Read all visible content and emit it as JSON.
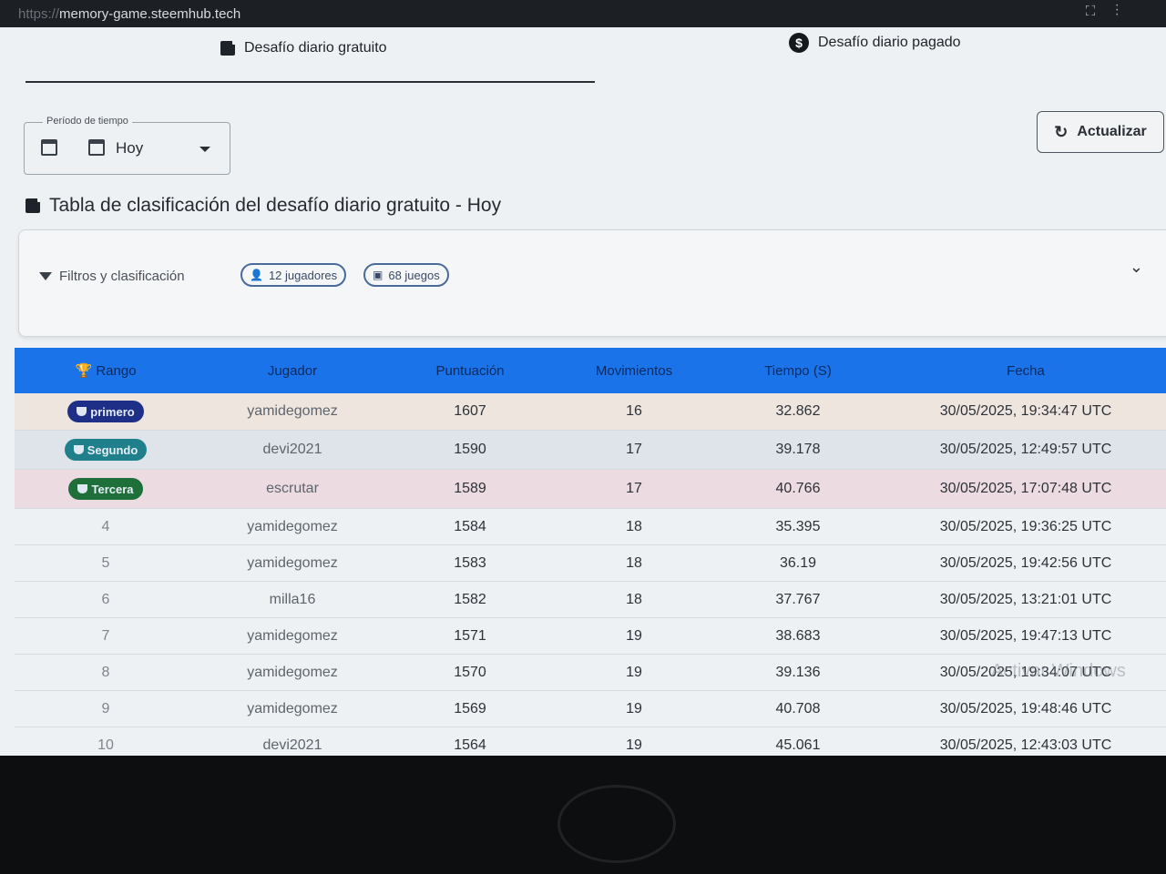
{
  "browser": {
    "scheme": "https://",
    "host": "memory-game.steemhub.tech"
  },
  "tabs": {
    "free": "Desafío diario gratuito",
    "paid": "Desafío diario pagado"
  },
  "period": {
    "label": "Período de tiempo",
    "value": "Hoy"
  },
  "refresh_label": "Actualizar",
  "board_title": "Tabla de clasificación del desafío diario gratuito - Hoy",
  "filters": {
    "label": "Filtros y clasificación",
    "players_chip": "12 jugadores",
    "games_chip": "68 juegos"
  },
  "table": {
    "headers": [
      "Rango",
      "Jugador",
      "Puntuación",
      "Movimientos",
      "Tiempo (S)",
      "Fecha"
    ],
    "rows": [
      {
        "rank": "primero",
        "player": "yamidegomez",
        "score": "1607",
        "moves": "16",
        "time": "32.862",
        "date": "30/05/2025, 19:34:47 UTC"
      },
      {
        "rank": "Segundo",
        "player": "devi2021",
        "score": "1590",
        "moves": "17",
        "time": "39.178",
        "date": "30/05/2025, 12:49:57 UTC"
      },
      {
        "rank": "Tercera",
        "player": "escrutar",
        "score": "1589",
        "moves": "17",
        "time": "40.766",
        "date": "30/05/2025, 17:07:48 UTC"
      },
      {
        "rank": "4",
        "player": "yamidegomez",
        "score": "1584",
        "moves": "18",
        "time": "35.395",
        "date": "30/05/2025, 19:36:25 UTC"
      },
      {
        "rank": "5",
        "player": "yamidegomez",
        "score": "1583",
        "moves": "18",
        "time": "36.19",
        "date": "30/05/2025, 19:42:56 UTC"
      },
      {
        "rank": "6",
        "player": "milla16",
        "score": "1582",
        "moves": "18",
        "time": "37.767",
        "date": "30/05/2025, 13:21:01 UTC"
      },
      {
        "rank": "7",
        "player": "yamidegomez",
        "score": "1571",
        "moves": "19",
        "time": "38.683",
        "date": "30/05/2025, 19:47:13 UTC"
      },
      {
        "rank": "8",
        "player": "yamidegomez",
        "score": "1570",
        "moves": "19",
        "time": "39.136",
        "date": "30/05/2025, 19:34:07 UTC"
      },
      {
        "rank": "9",
        "player": "yamidegomez",
        "score": "1569",
        "moves": "19",
        "time": "40.708",
        "date": "30/05/2025, 19:48:46 UTC"
      },
      {
        "rank": "10",
        "player": "devi2021",
        "score": "1564",
        "moves": "19",
        "time": "45.061",
        "date": "30/05/2025, 12:43:03 UTC"
      }
    ]
  },
  "watermark": "Activar Windows",
  "colors": {
    "header_blue": "#1a73e8",
    "first": "#1d2f86",
    "second": "#1f7f8a",
    "third": "#1f6f3a"
  }
}
